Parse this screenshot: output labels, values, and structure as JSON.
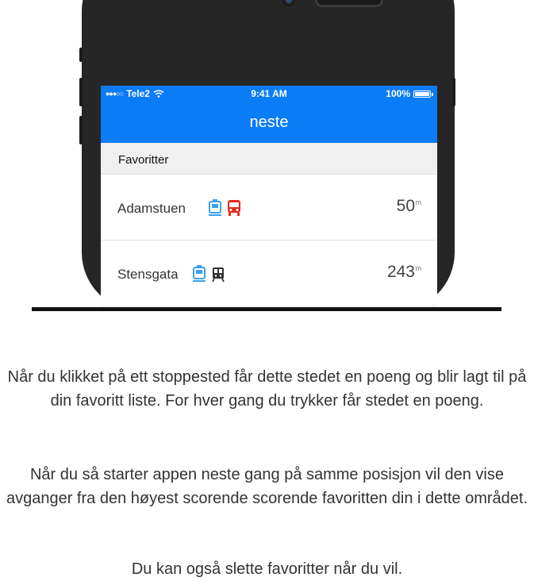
{
  "status_bar": {
    "carrier": "Tele2",
    "time": "9:41 AM",
    "battery": "100%"
  },
  "nav": {
    "title": "neste"
  },
  "favorites": {
    "header": "Favoritter",
    "items": [
      {
        "name": "Adamstuen",
        "distance": "50",
        "unit": "m",
        "icons": [
          "tram-icon",
          "bus-icon"
        ]
      },
      {
        "name": "Stensgata",
        "distance": "243",
        "unit": "m",
        "icons": [
          "tram-icon",
          "train-icon"
        ]
      }
    ]
  },
  "colors": {
    "accent": "#0a7cf5",
    "tram": "#3aa0f0",
    "bus": "#e12c1e",
    "train": "#333333"
  },
  "text": {
    "p1": "Når du klikket på ett stoppested får dette stedet en poeng og blir lagt til på din favoritt liste. For hver gang du trykker får stedet en poeng.",
    "p2": "Når du så starter appen neste gang på samme posisjon vil den vise avganger fra den høyest scorende scorende favoritten din i dette området.",
    "p3": "Du kan også slette favoritter når du vil."
  }
}
